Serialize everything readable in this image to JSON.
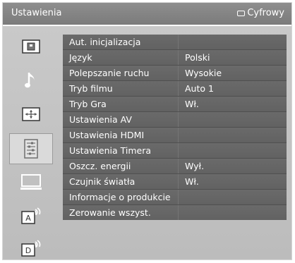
{
  "header": {
    "title": "Ustawienia",
    "source_label": "Cyfrowy"
  },
  "sidebar": {
    "items": [
      {
        "icon": "picture-icon"
      },
      {
        "icon": "music-note-icon"
      },
      {
        "icon": "screen-size-icon"
      },
      {
        "icon": "settings-list-icon",
        "selected": true
      },
      {
        "icon": "monitor-icon"
      },
      {
        "icon": "analog-channel-icon",
        "glyph": "A"
      },
      {
        "icon": "digital-channel-icon",
        "glyph": "D"
      }
    ]
  },
  "menu": {
    "rows": [
      {
        "label": "Aut. inicjalizacja",
        "value": ""
      },
      {
        "label": "Język",
        "value": "Polski"
      },
      {
        "label": "Polepszanie ruchu",
        "value": "Wysokie"
      },
      {
        "label": "Tryb filmu",
        "value": "Auto 1"
      },
      {
        "label": "Tryb Gra",
        "value": "Wł."
      },
      {
        "label": "Ustawienia AV",
        "value": ""
      },
      {
        "label": "Ustawienia HDMI",
        "value": ""
      },
      {
        "label": "Ustawienia Timera",
        "value": ""
      },
      {
        "label": "Oszcz. energii",
        "value": "Wył."
      },
      {
        "label": "Czujnik światła",
        "value": "Wł."
      },
      {
        "label": "Informacje o produkcie",
        "value": ""
      },
      {
        "label": "Zerowanie wszyst.",
        "value": ""
      }
    ]
  },
  "colors": {
    "titlebar": "#7b7b7b",
    "panel": "#c2c2c2",
    "row": "#666666",
    "text": "#ffffff"
  }
}
